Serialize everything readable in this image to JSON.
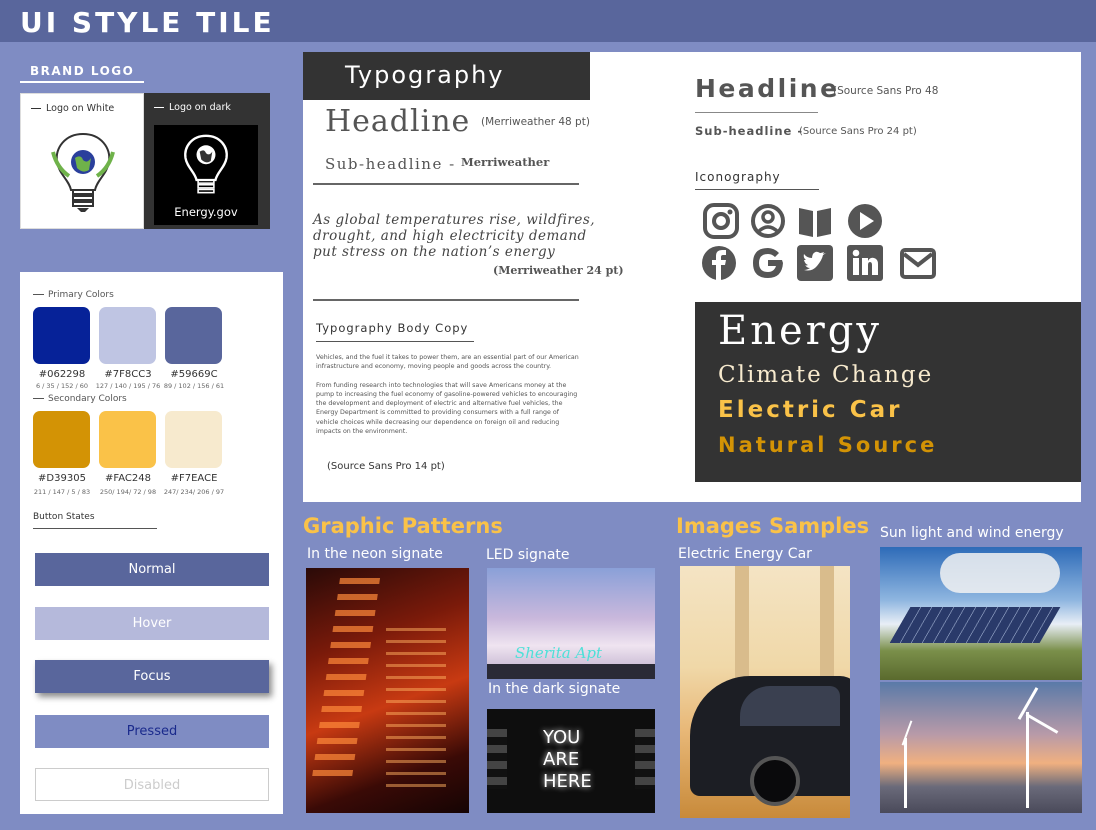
{
  "title": "UI STYLE TILE",
  "brand": {
    "heading": "BRAND LOGO",
    "logo_white_label": "Logo on White",
    "logo_dark_label": "Logo on dark",
    "logo_dark_text": "Energy.gov"
  },
  "colors": {
    "primary_label": "Primary Colors",
    "primary": [
      {
        "hex": "#062298",
        "rgb": "6 / 35 / 152 / 60",
        "color": "#062298"
      },
      {
        "hex": "#7F8CC3",
        "rgb": "127 / 140 / 195 / 76",
        "color": "#bfc5e3"
      },
      {
        "hex": "#59669C",
        "rgb": "89 / 102 / 156 / 61",
        "color": "#59669c"
      }
    ],
    "secondary_label": "Secondary Colors",
    "secondary": [
      {
        "hex": "#D39305",
        "rgb": "211 / 147 / 5 / 83",
        "color": "#d39305"
      },
      {
        "hex": "#FAC248",
        "rgb": "250/ 194/ 72 / 98",
        "color": "#fac248"
      },
      {
        "hex": "#F7EACE",
        "rgb": "247/ 234/ 206 / 97",
        "color": "#f7eace"
      }
    ]
  },
  "buttons": {
    "label": "Button States",
    "normal": "Normal",
    "hover": "Hover",
    "focus": "Focus",
    "pressed": "Pressed",
    "disabled": "Disabled"
  },
  "typography": {
    "banner": "Typography",
    "headline": "Headline",
    "headline_note": "(Merriweather 48 pt)",
    "subheadline": "Sub-headline -",
    "subheadline_note": "Merriweather",
    "quote": "As global temperatures rise, wildfires, drought, and high electricity demand put stress on the nation’s energy",
    "quote_note": "(Merriweather 24 pt)",
    "body_heading": "Typography Body Copy",
    "body_p1": "Vehicles, and the fuel it takes to power them, are an essential part of our American infrastructure and economy, moving people and goods across the country.",
    "body_p2": "From funding research into technologies that will save Americans money at the pump to increasing the fuel economy of gasoline-powered vehicles to encouraging the development and deployment of electric and alternative fuel vehicles, the Energy Department is committed to providing consumers with a full range of vehicle choices while decreasing our dependence on foreign oil and reducing impacts on the environment.",
    "body_note": "(Source Sans Pro 14 pt)",
    "headline_right": "Headline",
    "headline_right_note": "(Source Sans Pro 48",
    "subheadline_right": "Sub-headline -",
    "subheadline_right_note": "(Source Sans Pro 24 pt)",
    "iconography": "Iconography",
    "energy": "Energy",
    "climate": "Climate Change",
    "electric": "Electric Car",
    "natural": "Natural Source"
  },
  "icons": [
    "instagram-icon",
    "user-circle-icon",
    "book-icon",
    "play-icon",
    "facebook-icon",
    "google-icon",
    "twitter-icon",
    "linkedin-icon",
    "mail-icon"
  ],
  "patterns": {
    "title": "Graphic Patterns",
    "neon": "In the neon signate",
    "led": "LED signate",
    "dark": "In the dark signate",
    "led_sign_text": "Sherita Apt",
    "dark_sign_lines": [
      "YOU",
      "ARE",
      "HERE"
    ]
  },
  "images": {
    "title": "Images Samples",
    "car": "Electric Energy Car",
    "sun": "Sun light and wind energy"
  }
}
